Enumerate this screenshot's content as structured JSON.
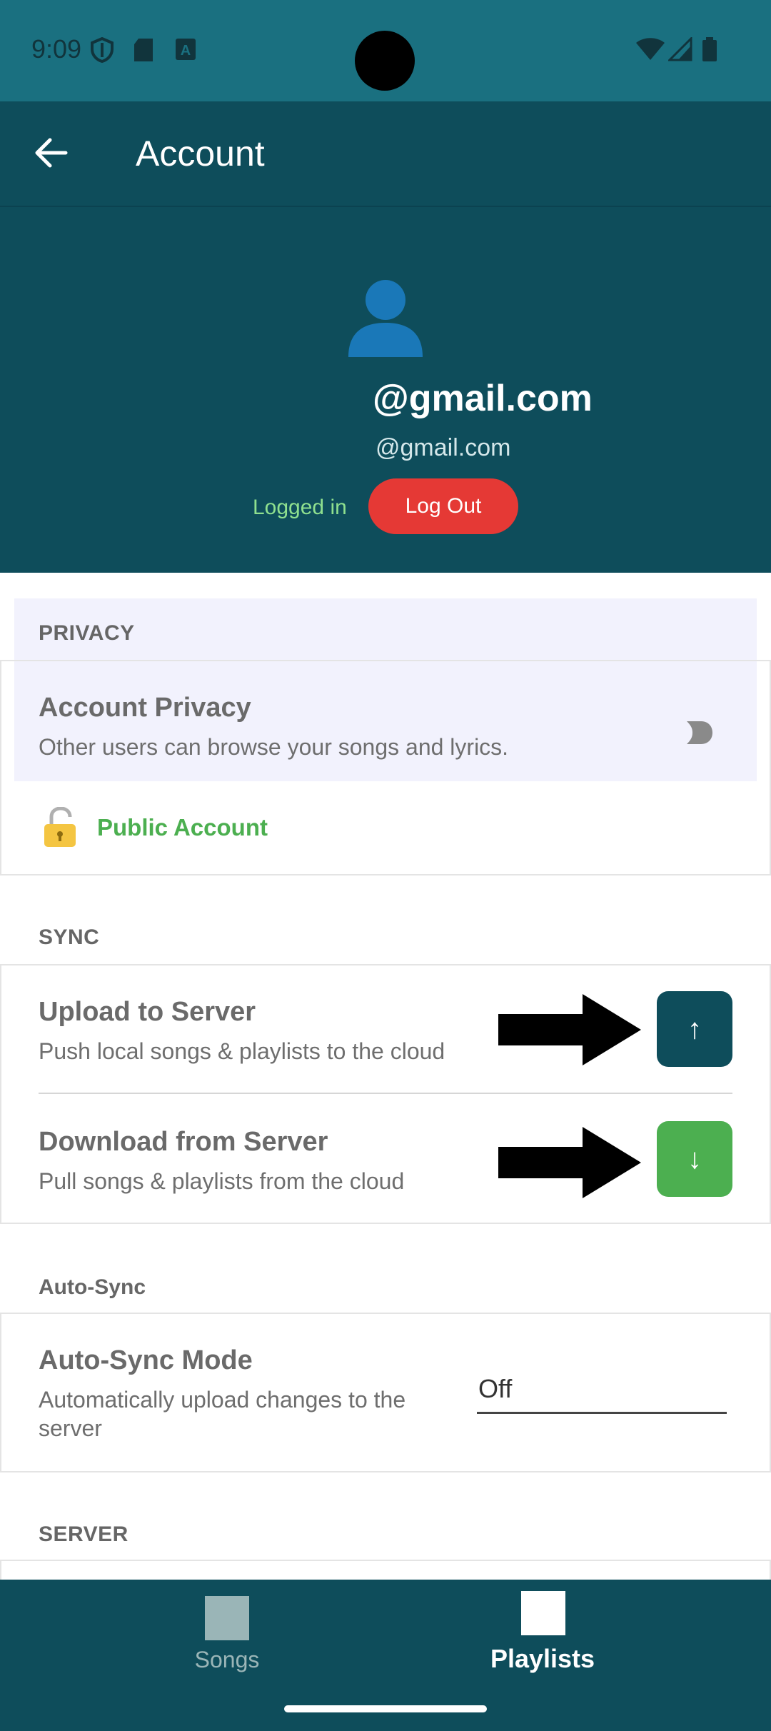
{
  "status_bar": {
    "time": "9:09",
    "left_icons": [
      "shield-icon",
      "sd-card-icon",
      "font-app-icon"
    ],
    "right_icons": [
      "wifi-icon",
      "cell-signal-icon",
      "battery-icon"
    ]
  },
  "app_bar": {
    "title": "Account",
    "back_icon": "arrow-back-icon"
  },
  "profile": {
    "avatar_icon": "person-icon",
    "name": "@gmail.com",
    "email": "@gmail.com",
    "status": "Logged in",
    "logout_label": "Log Out"
  },
  "privacy": {
    "header": "PRIVACY",
    "title": "Account Privacy",
    "subtitle": "Other users can browse your songs and lyrics.",
    "toggle_on": false,
    "status_icon": "open-lock-icon",
    "status_label": "Public Account"
  },
  "sync": {
    "header": "SYNC",
    "upload": {
      "title": "Upload to Server",
      "subtitle": "Push local songs & playlists to the cloud",
      "button_glyph": "↑"
    },
    "download": {
      "title": "Download from Server",
      "subtitle": "Pull songs & playlists from the cloud",
      "button_glyph": "↓"
    }
  },
  "auto_sync": {
    "header": "Auto-Sync",
    "title": "Auto-Sync Mode",
    "subtitle_line1": "Automatically upload changes to the",
    "subtitle_line2": "server",
    "selected_value": "Off"
  },
  "server": {
    "header": "SERVER"
  },
  "bottom_nav": {
    "items": [
      {
        "label": "Songs",
        "active": false
      },
      {
        "label": "Playlists",
        "active": true
      }
    ]
  },
  "colors": {
    "status_bar": "#1a7080",
    "primary_dark": "#0e4d5b",
    "logout_red": "#e53935",
    "upload_button": "#0e4d5b",
    "download_button": "#4caf50",
    "public_green": "#4caf50",
    "privacy_bg": "#f2f2fd"
  }
}
